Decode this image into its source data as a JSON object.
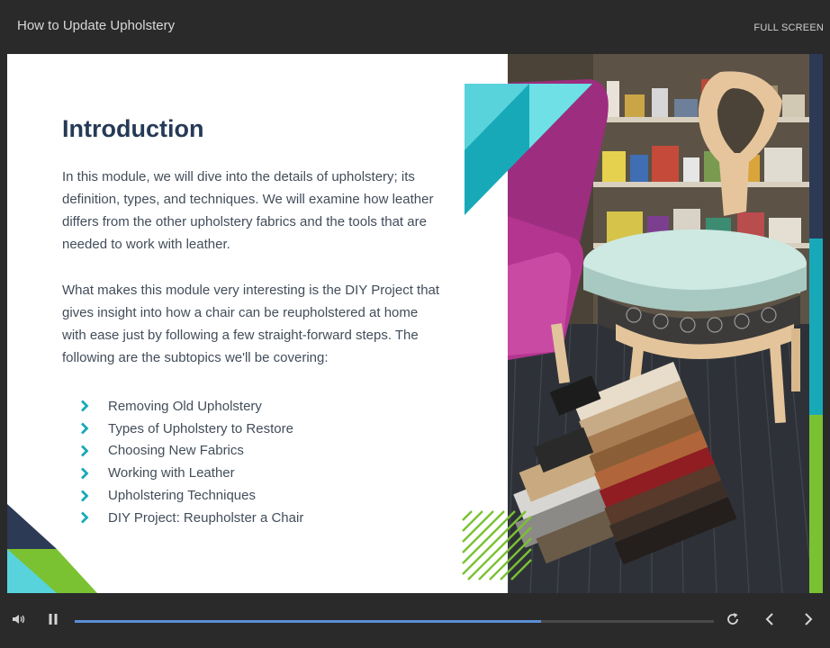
{
  "header": {
    "course_title": "How to Update Upholstery",
    "fullscreen_label": "FULL SCREEN"
  },
  "slide": {
    "heading": "Introduction",
    "paragraphs": [
      "In this module, we will dive into the details of upholstery; its definition, types, and techniques. We will examine how leather differs from the other upholstery fabrics and the tools that are needed to work with leather.",
      "What makes this module very interesting is the DIY Project that gives insight into how a chair can be reupholstered at home with ease just by following a few straight-forward steps. The following are the subtopics we'll be covering:"
    ],
    "subtopics": [
      "Removing Old Upholstery",
      "Types of Upholstery to Restore",
      "Choosing New Fabrics",
      "Working with Leather",
      "Upholstering Techniques",
      "DIY Project: Reupholster a Chair"
    ]
  },
  "player": {
    "progress_fraction": 0.73,
    "icons": {
      "volume": "volume-icon",
      "pause": "pause-icon",
      "replay": "replay-icon",
      "previous": "chevron-left-icon",
      "next": "chevron-right-icon",
      "bullet": "chevron-right-icon"
    }
  },
  "colors": {
    "accent_teal": "#18a9b8",
    "accent_green": "#7ac232",
    "heading_navy": "#263a57",
    "progress_blue": "#5a8fd6",
    "player_bg": "#2a2a2b"
  }
}
